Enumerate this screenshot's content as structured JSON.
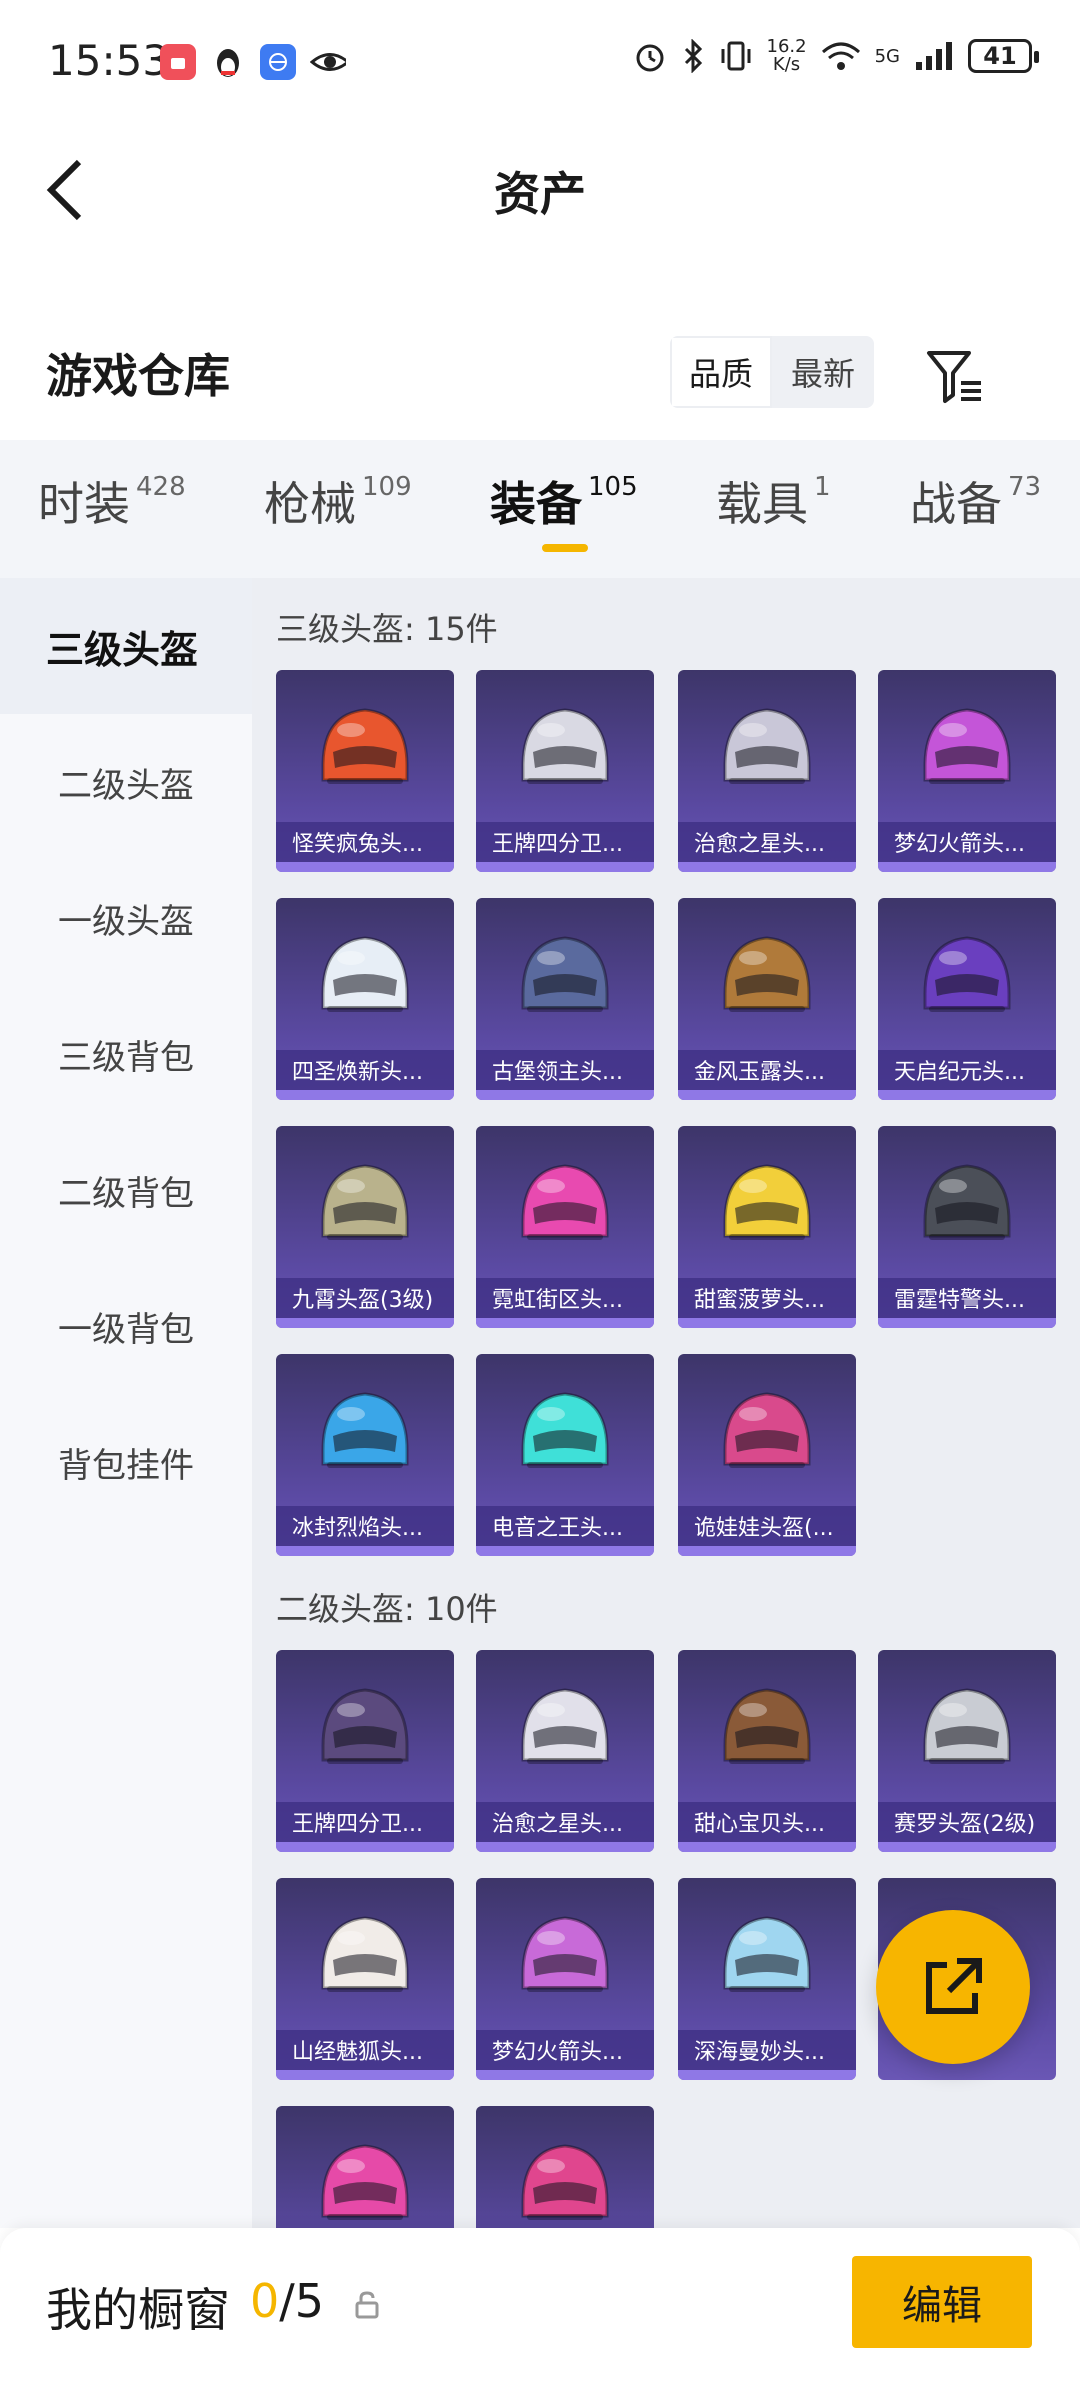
{
  "status": {
    "time": "15:53",
    "net_speed_value": "16.2",
    "net_speed_unit": "K/s",
    "network": "5G",
    "battery": "41"
  },
  "header": {
    "title": "资产"
  },
  "section": {
    "title": "游戏仓库",
    "sort_options": [
      "品质",
      "最新"
    ],
    "active_sort": "品质"
  },
  "tabs": [
    {
      "label": "时装",
      "count": "428"
    },
    {
      "label": "枪械",
      "count": "109"
    },
    {
      "label": "装备",
      "count": "105"
    },
    {
      "label": "载具",
      "count": "1"
    },
    {
      "label": "战备",
      "count": "73"
    }
  ],
  "active_tab": "装备",
  "sidebar": {
    "items": [
      "三级头盔",
      "二级头盔",
      "一级头盔",
      "三级背包",
      "二级背包",
      "一级背包",
      "背包挂件"
    ],
    "active": "三级头盔"
  },
  "groups": [
    {
      "title": "三级头盔: 15件",
      "items": [
        {
          "name": "怪笑疯兔头...",
          "color": "#e8562e"
        },
        {
          "name": "王牌四分卫...",
          "color": "#d9d9e3"
        },
        {
          "name": "治愈之星头...",
          "color": "#c9c7d8"
        },
        {
          "name": "梦幻火箭头...",
          "color": "#c455d8"
        },
        {
          "name": "四圣焕新头...",
          "color": "#e7eef6"
        },
        {
          "name": "古堡领主头...",
          "color": "#5a6a9e"
        },
        {
          "name": "金风玉露头...",
          "color": "#b07a3a"
        },
        {
          "name": "天启纪元头...",
          "color": "#6a3fbf"
        },
        {
          "name": "九霄头盔(3级)",
          "color": "#b9b28c"
        },
        {
          "name": "霓虹街区头...",
          "color": "#e84ab0"
        },
        {
          "name": "甜蜜菠萝头...",
          "color": "#f2cf3a"
        },
        {
          "name": "雷霆特警头...",
          "color": "#4b4f58"
        },
        {
          "name": "冰封烈焰头...",
          "color": "#3aa6e8"
        },
        {
          "name": "电音之王头...",
          "color": "#3fe0d8"
        },
        {
          "name": "诡娃娃头盔(...",
          "color": "#d94a8c"
        }
      ]
    },
    {
      "title": "二级头盔: 10件",
      "items": [
        {
          "name": "王牌四分卫...",
          "color": "#5b4a7e"
        },
        {
          "name": "治愈之星头...",
          "color": "#e1e0ea"
        },
        {
          "name": "甜心宝贝头...",
          "color": "#8a5a38"
        },
        {
          "name": "赛罗头盔(2级)",
          "color": "#c9ccd3"
        },
        {
          "name": "山经魅狐头...",
          "color": "#f1ece8"
        },
        {
          "name": "梦幻火箭头...",
          "color": "#c86ad8"
        },
        {
          "name": "深海曼妙头...",
          "color": "#9fd6f0"
        },
        {
          "name": "",
          "color": "#6b3ab0"
        },
        {
          "name": "",
          "color": "#e64aa8"
        },
        {
          "name": "",
          "color": "#e0468e"
        }
      ]
    }
  ],
  "showcase": {
    "label": "我的橱窗",
    "current": "0",
    "total": "/5"
  },
  "edit_button": "编辑",
  "colors": {
    "accent": "#f7b500",
    "card_bg": "#4a3f8c"
  }
}
